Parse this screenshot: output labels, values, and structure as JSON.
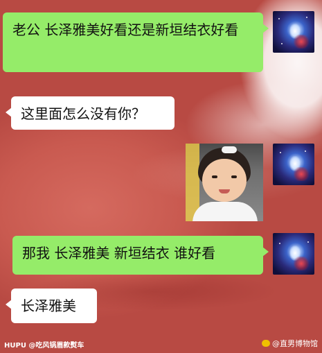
{
  "messages": [
    {
      "side": "out",
      "text": "老公 长泽雅美好看还是新垣结衣好看"
    },
    {
      "side": "in",
      "text": "这里面怎么没有你？"
    },
    {
      "side": "out",
      "kind": "image",
      "image_desc": "kid-smiling-sticker"
    },
    {
      "side": "out",
      "text": "那我 长泽雅美 新垣结衣 谁好看"
    },
    {
      "side": "in",
      "text": "长泽雅美"
    }
  ],
  "watermark": {
    "left": "HUPU @吃风锅眉款熨车",
    "right": "@直男博物馆"
  },
  "colors": {
    "out_bubble": "#95ec69",
    "in_bubble": "#ffffff",
    "background": "#c9574d"
  }
}
